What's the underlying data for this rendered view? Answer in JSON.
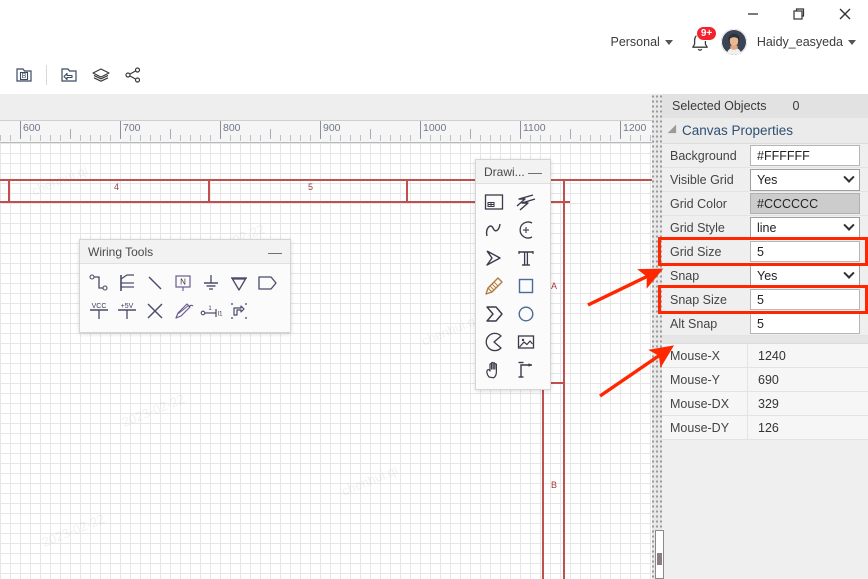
{
  "window": {
    "minimize_label": "minimize",
    "restore_label": "restore",
    "close_label": "close"
  },
  "account": {
    "workspace": "Personal",
    "notification_count": "9+",
    "username": "Haidy_easyeda"
  },
  "toolstrip": {
    "items": [
      {
        "name": "board-icon",
        "title": "B"
      },
      {
        "name": "image-back-icon",
        "title": ""
      },
      {
        "name": "layers-icon",
        "title": ""
      },
      {
        "name": "share-icon",
        "title": ""
      }
    ]
  },
  "ruler": {
    "labels": [
      "600",
      "700",
      "800",
      "900",
      "1000",
      "1100",
      "1200"
    ],
    "positions": [
      20,
      120,
      220,
      320,
      420,
      520,
      620
    ]
  },
  "schematic": {
    "column_labels": [
      "4",
      "5"
    ],
    "row_labels": [
      "A",
      "B"
    ]
  },
  "wiring_tools": {
    "title": "Wiring Tools",
    "minimize": "—",
    "row1": [
      "wire-icon",
      "bus-icon",
      "bus-entry-icon",
      "netlabel-icon",
      "gnd-icon",
      "vdd-flag-icon",
      "netport-icon"
    ],
    "row2": [
      "vcc-icon",
      "plus5v-icon",
      "no-connect-icon",
      "probe-icon",
      "pin-icon",
      "netflag-icon"
    ]
  },
  "drawing_tools": {
    "title": "Drawi...",
    "minimize": "—",
    "items": [
      "sheet-icon",
      "polyline-icon",
      "bezier-icon",
      "arc-icon",
      "polygon-icon",
      "text-icon",
      "pencil-icon",
      "rectangle-icon",
      "chevron-shape-icon",
      "circle-icon",
      "pie-icon",
      "image-icon",
      "hand-icon",
      "dimension-icon"
    ]
  },
  "properties": {
    "selected_objects_label": "Selected Objects",
    "selected_objects_value": "0",
    "section_title": "Canvas Properties",
    "rows": [
      {
        "label": "Background",
        "value": "#FFFFFF",
        "type": "text"
      },
      {
        "label": "Visible Grid",
        "value": "Yes",
        "type": "select"
      },
      {
        "label": "Grid Color",
        "value": "#CCCCCC",
        "type": "swatch",
        "swatch_color": "#CCCCCC"
      },
      {
        "label": "Grid Style",
        "value": "line",
        "type": "select"
      },
      {
        "label": "Grid Size",
        "value": "5",
        "type": "text",
        "highlighted": true
      },
      {
        "label": "Snap",
        "value": "Yes",
        "type": "select"
      },
      {
        "label": "Snap Size",
        "value": "5",
        "type": "text",
        "highlighted": true
      },
      {
        "label": "Alt Snap",
        "value": "5",
        "type": "text"
      }
    ],
    "mouse_rows": [
      {
        "label": "Mouse-X",
        "value": "1240"
      },
      {
        "label": "Mouse-Y",
        "value": "690"
      },
      {
        "label": "Mouse-DX",
        "value": "329"
      },
      {
        "label": "Mouse-DY",
        "value": "126"
      }
    ]
  },
  "annotations": {
    "highlight_color": "#FF2600",
    "arrow_count": "2"
  },
  "colors": {
    "frame_red": "#C0504D",
    "grid_gray": "#E6E6E6",
    "panel_bg": "#EFEFEF",
    "badge_red": "#F5222D"
  }
}
